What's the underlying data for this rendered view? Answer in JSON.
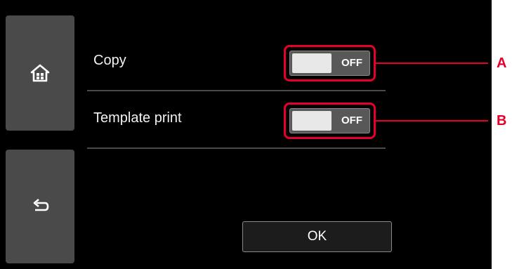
{
  "sidebar": {
    "home_icon": "home-icon",
    "back_icon": "back-arrow-icon"
  },
  "settings": [
    {
      "label": "Copy",
      "state": "OFF",
      "callout": "A"
    },
    {
      "label": "Template print",
      "state": "OFF",
      "callout": "B"
    }
  ],
  "ok_label": "OK",
  "colors": {
    "screen": "#000000",
    "accent_callout": "#e4002b",
    "side_button": "#4a4a4a"
  }
}
